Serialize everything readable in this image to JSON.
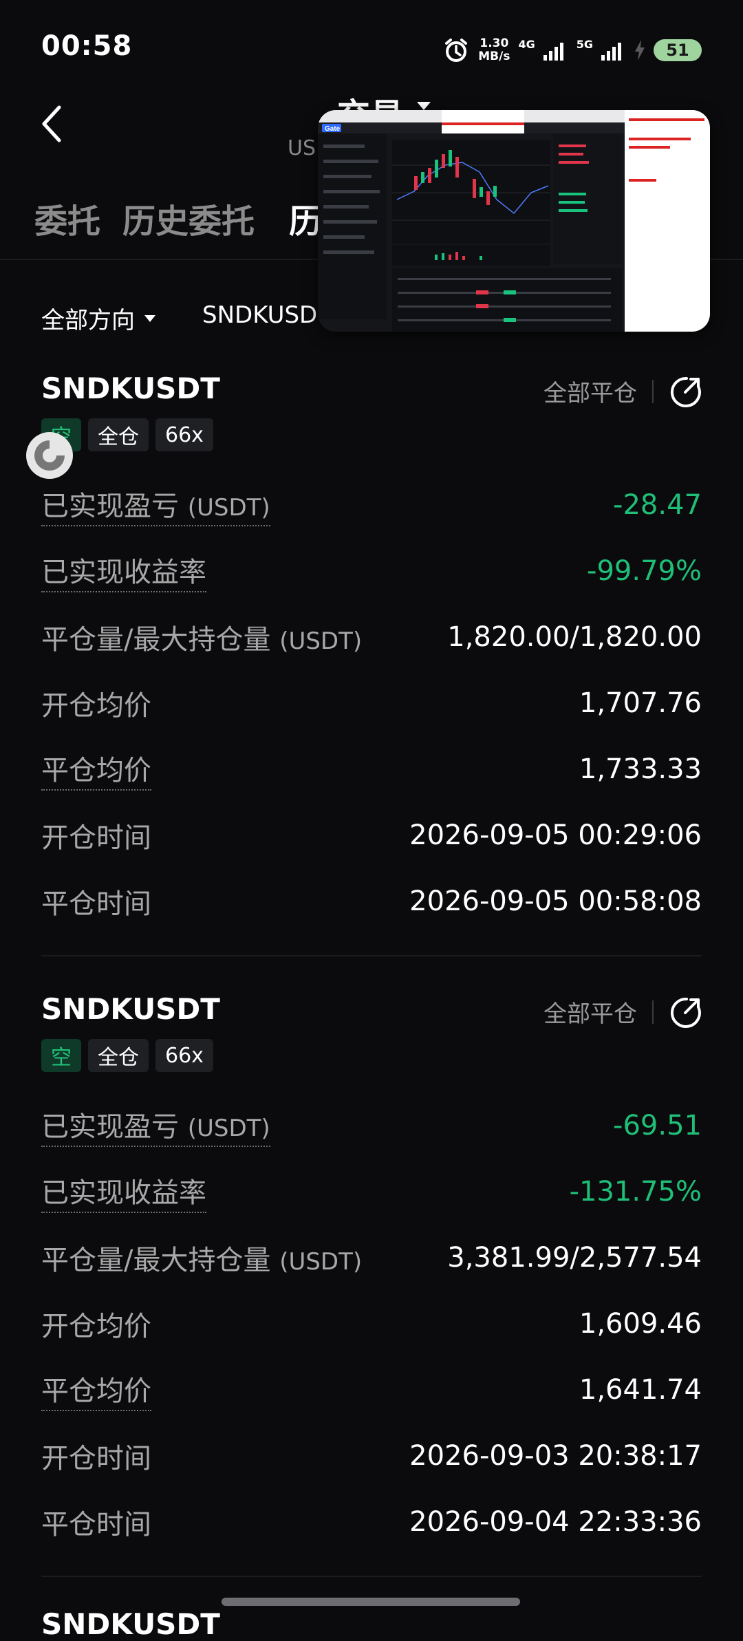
{
  "status": {
    "time": "00:58",
    "speed_value": "1.30",
    "speed_unit": "MB/s",
    "net1": "4G",
    "net2": "5G",
    "battery": "51"
  },
  "header": {
    "title": "交易",
    "subtitle": "US"
  },
  "tabs": [
    "委托",
    "历史委托",
    "历"
  ],
  "filters": {
    "direction": "全部方向",
    "symbol": "SNDKUSD"
  },
  "labels": {
    "close_all": "全部平仓",
    "realized_pnl": "已实现盈亏",
    "realized_pnl_unit": "(USDT)",
    "realized_rate": "已实现收益率",
    "close_max": "平仓量/最大持仓量",
    "close_max_unit": "(USDT)",
    "open_avg": "开仓均价",
    "close_avg": "平仓均价",
    "open_time": "开仓时间",
    "close_time": "平仓时间"
  },
  "positions": [
    {
      "symbol": "SNDKUSDT",
      "side": "空",
      "margin": "全仓",
      "leverage": "66x",
      "realized_pnl": "-28.47",
      "realized_rate": "-99.79%",
      "close_max": "1,820.00/1,820.00",
      "open_avg": "1,707.76",
      "close_avg": "1,733.33",
      "open_time": "2026-09-05 00:29:06",
      "close_time": "2026-09-05 00:58:08"
    },
    {
      "symbol": "SNDKUSDT",
      "side": "空",
      "margin": "全仓",
      "leverage": "66x",
      "realized_pnl": "-69.51",
      "realized_rate": "-131.75%",
      "close_max": "3,381.99/2,577.54",
      "open_avg": "1,609.46",
      "close_avg": "1,641.74",
      "open_time": "2026-09-03 20:38:17",
      "close_time": "2026-09-04 22:33:36"
    },
    {
      "symbol": "SNDKUSDT"
    }
  ],
  "icons": {
    "back": "chevron-left-icon",
    "share": "share-icon",
    "alarm": "alarm-icon",
    "signal": "signal-icon",
    "charging": "bolt-icon",
    "fab": "loading-ring-icon"
  },
  "colors": {
    "green": "#1fbf78",
    "background": "#0b0b0d",
    "muted": "#a8a8a8"
  },
  "thumbnail": {
    "brand": "Gate"
  }
}
